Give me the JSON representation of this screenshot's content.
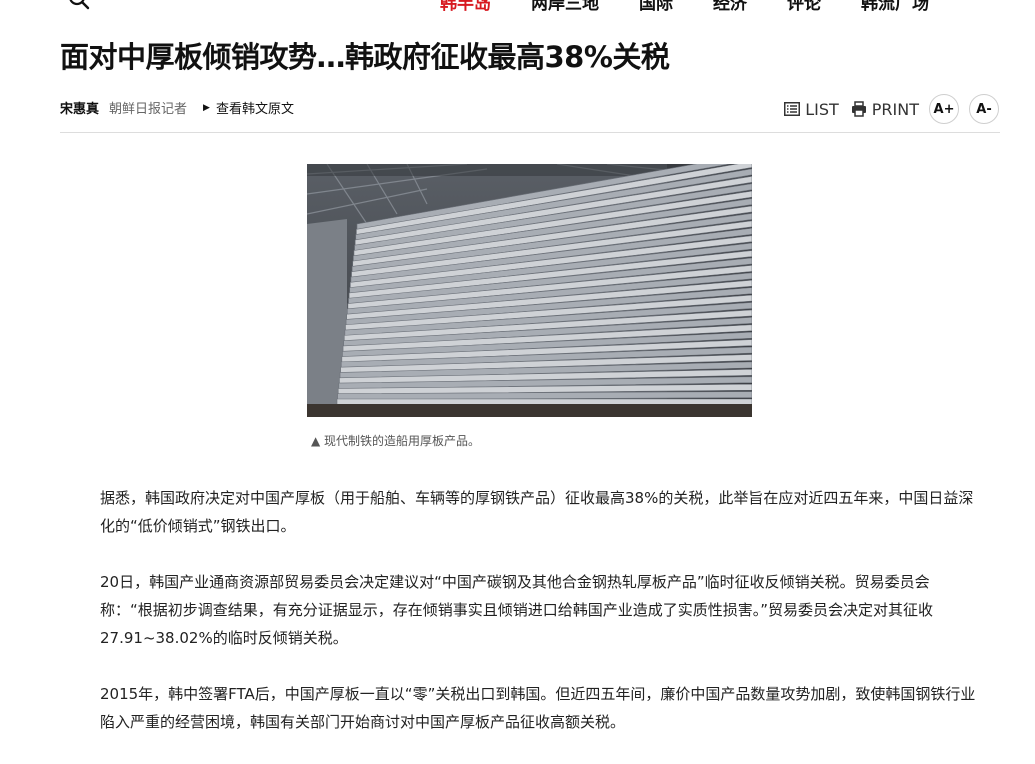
{
  "nav": {
    "items": [
      {
        "label": "韩半岛",
        "active": true
      },
      {
        "label": "两岸三地",
        "active": false
      },
      {
        "label": "国际",
        "active": false
      },
      {
        "label": "经济",
        "active": false
      },
      {
        "label": "评论",
        "active": false
      },
      {
        "label": "韩流广场",
        "active": false
      }
    ]
  },
  "article": {
    "title": "面对中厚板倾销攻势…韩政府征收最高38%关税",
    "author": "宋惠真",
    "author_role": "朝鲜日报记者",
    "original_link": "查看韩文原文",
    "image_caption": "▲ 现代制铁的造船用厚板产品。",
    "paragraphs": [
      "据悉，韩国政府决定对中国产厚板（用于船舶、车辆等的厚钢铁产品）征收最高38%的关税，此举旨在应对近四五年来，中国日益深化的“低价倾销式”钢铁出口。",
      "20日，韩国产业通商资源部贸易委员会决定建议对“中国产碳钢及其他合金钢热轧厚板产品”临时征收反倾销关税。贸易委员会称：“根据初步调查结果，有充分证据显示，存在倾销事实且倾销进口给韩国产业造成了实质性损害。”贸易委员会决定对其征收27.91~38.02%的临时反倾销关税。",
      "2015年，韩中签署FTA后，中国产厚板一直以“零”关税出口到韩国。但近四五年间，廉价中国产品数量攻势加剧，致使韩国钢铁行业陷入严重的经营困境，韩国有关部门开始商讨对中国产厚板产品征收高额关税。"
    ]
  },
  "tools": {
    "list_label": "LIST",
    "print_label": "PRINT",
    "font_up": "A+",
    "font_down": "A-"
  },
  "colors": {
    "accent": "#d71920"
  },
  "icons": {
    "search": "search-icon",
    "list": "list-icon",
    "print": "print-icon"
  }
}
